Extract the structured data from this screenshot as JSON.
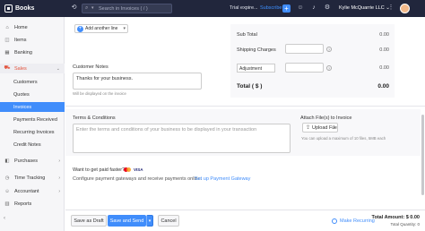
{
  "topbar": {
    "app_name": "Books",
    "search_placeholder": "Search in Invoices ( / )",
    "trial_text": "Trial expire...",
    "subscribe_label": "Subscribe",
    "org_name": "Kylie McQuarrie LLC",
    "org_caret": "⌄"
  },
  "sidebar": {
    "items": [
      {
        "label": "Home",
        "icon": "home-icon"
      },
      {
        "label": "Items",
        "icon": "items-icon"
      },
      {
        "label": "Banking",
        "icon": "banking-icon"
      },
      {
        "label": "Sales",
        "icon": "cart-icon"
      },
      {
        "label": "Customers"
      },
      {
        "label": "Quotes"
      },
      {
        "label": "Invoices"
      },
      {
        "label": "Payments Received"
      },
      {
        "label": "Recurring Invoices"
      },
      {
        "label": "Credit Notes"
      },
      {
        "label": "Purchases",
        "icon": "bag-icon"
      },
      {
        "label": "Time Tracking",
        "icon": "clock-icon"
      },
      {
        "label": "Accountant",
        "icon": "accountant-icon"
      },
      {
        "label": "Reports",
        "icon": "reports-icon"
      }
    ]
  },
  "items_table": {
    "add_line_label": "Add another line",
    "add_line_caret": "▾"
  },
  "totals": {
    "sub_total_label": "Sub Total",
    "sub_total_value": "0.00",
    "shipping_label": "Shipping Charges",
    "shipping_value": "0.00",
    "adjustment_label": "Adjustment",
    "adjustment_value": "0.00",
    "total_label": "Total ( $ )",
    "total_value": "0.00"
  },
  "customer_notes": {
    "label": "Customer Notes",
    "value": "Thanks for your business.",
    "hint": "Will be displayed on the invoice"
  },
  "terms": {
    "label": "Terms & Conditions",
    "placeholder": "Enter the terms and conditions of your business to be displayed in your transaction"
  },
  "attachments": {
    "label": "Attach File(s) to Invoice",
    "upload_label": "Upload File",
    "upload_caret": "⌄",
    "hint": "You can upload a maximum of 10 files, 5MB each"
  },
  "payment": {
    "heading": "Want to get paid faster?",
    "visa_label": "VISA",
    "description": "Configure payment gateways and receive payments online.",
    "link_label": "Set up Payment Gateway"
  },
  "footer": {
    "save_draft_label": "Save as Draft",
    "save_send_label": "Save and Send",
    "split_caret": "▾",
    "cancel_label": "Cancel",
    "recurring_label": "Make Recurring",
    "total_amount": "Total Amount: $ 0.00",
    "total_quantity": "Total Quantity: 0"
  },
  "colors": {
    "accent": "#408dfb",
    "topbar_bg": "#21263c",
    "active_section": "#e2513a"
  }
}
